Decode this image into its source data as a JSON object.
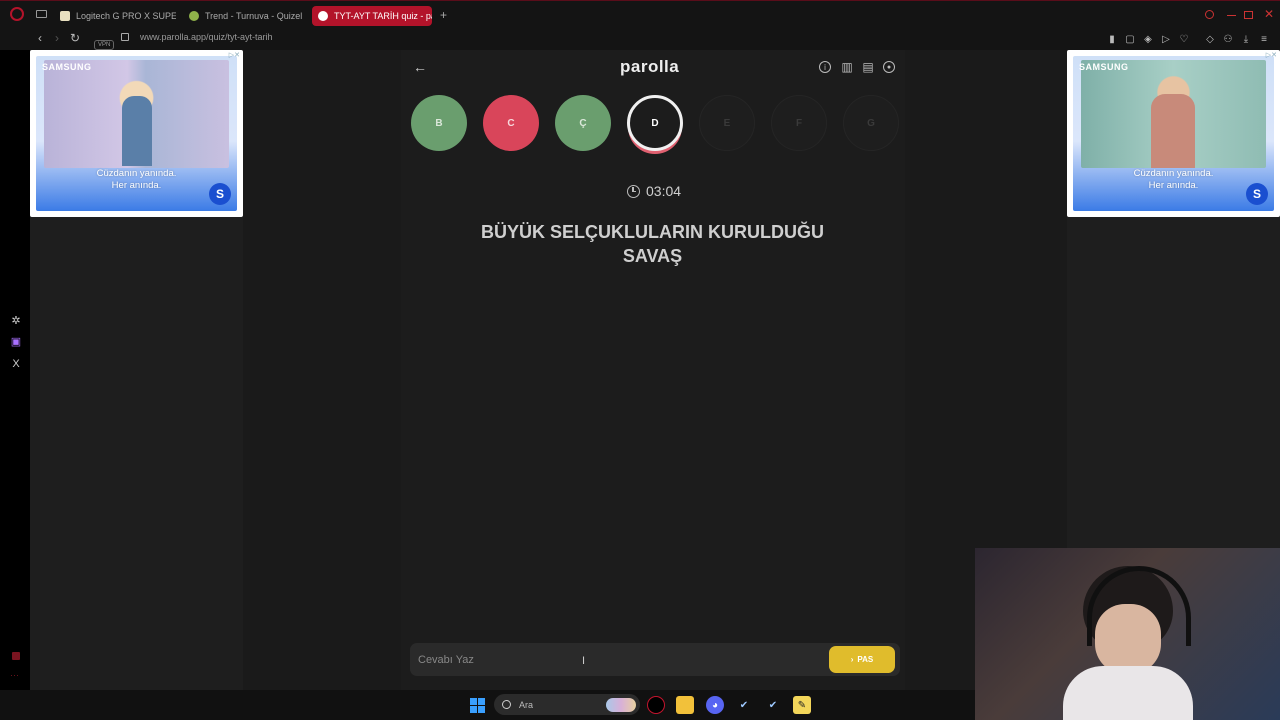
{
  "browser": {
    "tabs": [
      {
        "label": "Logitech G PRO X SUPERL"
      },
      {
        "label": "Trend - Turnuva - Quizel"
      },
      {
        "label": "TYT-AYT TARİH quiz - pa",
        "active": true
      }
    ],
    "vpn_label": "VPN",
    "url": "www.parolla.app/quiz/tyt-ayt-tarih"
  },
  "ads": {
    "left": {
      "brand": "SAMSUNG",
      "line1": "Cüzdanın yanında.",
      "line2": "Her anında."
    },
    "right": {
      "brand": "SAMSUNG",
      "line1": "Cüzdanın yanında.",
      "line2": "Her anında."
    },
    "logo_letter": "S"
  },
  "quiz": {
    "brand": "parolla",
    "letters": [
      {
        "letter": "B",
        "state": "correct"
      },
      {
        "letter": "C",
        "state": "wrong"
      },
      {
        "letter": "Ç",
        "state": "correct"
      },
      {
        "letter": "D",
        "state": "current"
      },
      {
        "letter": "E",
        "state": "pending"
      },
      {
        "letter": "F",
        "state": "pending"
      },
      {
        "letter": "G",
        "state": "pending"
      }
    ],
    "timer": "03:04",
    "question_line1": "BÜYÜK SELÇUKLULARIN KURULDUĞU",
    "question_line2": "SAVAŞ",
    "answer_placeholder": "Cevabı Yaz",
    "pass_label": "PAS"
  },
  "taskbar": {
    "search_label": "Ara"
  },
  "colors": {
    "correct": "#6a9e6e",
    "wrong": "#d9455a",
    "pass": "#e0bc2c",
    "accent": "#b3132a"
  }
}
